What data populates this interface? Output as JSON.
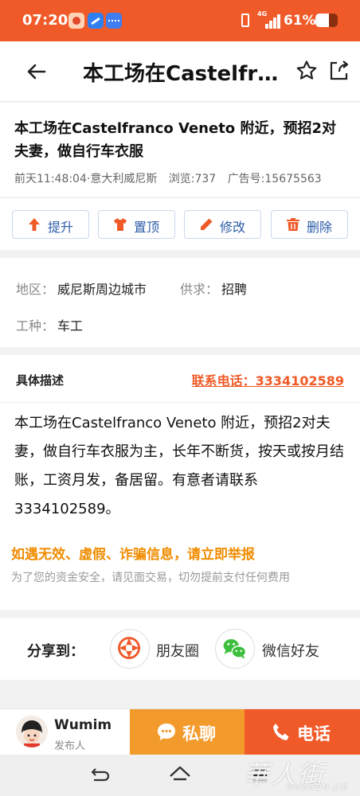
{
  "status_bar": {
    "time": "07:20",
    "network": "4G",
    "battery": "61%",
    "battery_level": 0.61
  },
  "header": {
    "title": "本工场在Castelfranco Veneto 附近，预招2对夫妻，做自行车衣服"
  },
  "post": {
    "title": "本工场在Castelfranco Veneto 附近，预招2对夫妻，做自行车衣服",
    "meta_time": "前天11:48:04·意大利威尼斯",
    "meta_views": "浏览:737",
    "meta_ad_id": "广告号:15675563"
  },
  "actions": [
    {
      "label": "提升",
      "icon": "arrow-up-icon"
    },
    {
      "label": "置顶",
      "icon": "shirt-icon"
    },
    {
      "label": "修改",
      "icon": "pencil-icon"
    },
    {
      "label": "删除",
      "icon": "trash-icon"
    }
  ],
  "info": {
    "region_key": "地区：",
    "region_value": "威尼斯周边城市",
    "supply_key": "供求：",
    "supply_value": "招聘",
    "job_key": "工种：",
    "job_value": "车工"
  },
  "description": {
    "label": "具体描述",
    "phone_link": "联系电话：3334102589",
    "body": "本工场在Castelfranco Veneto 附近，预招2对夫妻，做自行车衣服为主，长年不断货，按天或按月结账，工资月发，备居留。有意者请联系3334102589。",
    "warning_title": "如遇无效、虚假、诈骗信息，请立即举报",
    "warning_sub": "为了您的资金安全，请见面交易，切勿提前支付任何费用"
  },
  "share": {
    "label": "分享到：",
    "moments": "朋友圈",
    "wechat": "微信好友"
  },
  "contact": {
    "poster_name": "Wumim",
    "poster_role": "发布人",
    "pm_label": "私聊",
    "call_label": "电话"
  },
  "watermark": {
    "main": "華人街",
    "sub": "HUAREN.JIE"
  },
  "colors": {
    "brand": "#f05a28",
    "accent_orange": "#f39a2c",
    "warning": "#f08c00",
    "action_text": "#2d5da8",
    "action_icon": "#f05a28"
  }
}
